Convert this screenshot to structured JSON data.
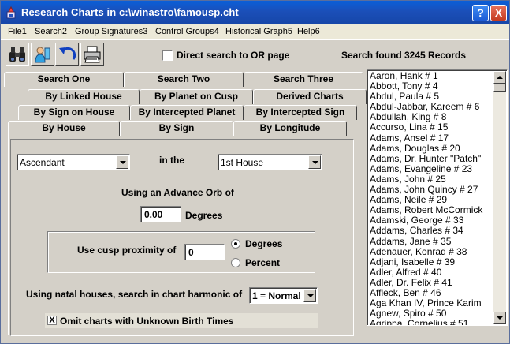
{
  "window": {
    "title": "Research Charts in c:\\winastro\\famousp.cht",
    "help_button": "?",
    "close_button": "X"
  },
  "menu": [
    {
      "label": "File",
      "num": "1"
    },
    {
      "label": "Search",
      "num": "2"
    },
    {
      "label": "Group Signatures",
      "num": "3"
    },
    {
      "label": "Control Groups",
      "num": "4"
    },
    {
      "label": "Historical Graph",
      "num": "5"
    },
    {
      "label": "Help",
      "num": "6"
    }
  ],
  "toolbar": {
    "icons": [
      "binoculars-icon",
      "person-search-icon",
      "undo-icon",
      "printer-icon"
    ],
    "direct_search_label": "Direct search to OR page",
    "direct_search_checked": false,
    "found_label": "Search found 3245 Records"
  },
  "tabs": {
    "row1": [
      "Search One",
      "Search Two",
      "Search Three"
    ],
    "row2": [
      "By Linked House",
      "By Planet on Cusp",
      "Derived Charts"
    ],
    "row3": [
      "By Sign on House",
      "By Intercepted Planet",
      "By Intercepted Sign"
    ],
    "row4": [
      "By House",
      "By Sign",
      "By Longitude"
    ],
    "active": "By House"
  },
  "form": {
    "planet_select": "Ascendant",
    "in_the_label": "in the",
    "house_select": "1st House",
    "orb_label": "Using an Advance Orb of",
    "orb_value": "0.00",
    "degrees_label": "Degrees",
    "cusp_label": "Use cusp proximity of",
    "cusp_value": "0",
    "radio_degrees": "Degrees",
    "radio_percent": "Percent",
    "radio_selected": "Degrees",
    "harmonic_label": "Using natal houses, search in chart harmonic of",
    "harmonic_select": "1 = Normal",
    "omit_label": "Omit charts with Unknown Birth Times",
    "omit_checked": true,
    "omit_check_mark": "X"
  },
  "list": [
    "Aaron, Hank  # 1",
    "Abbott, Tony  # 4",
    "Abdul, Paula  # 5",
    "Abdul-Jabbar, Kareem  # 6",
    "Abdullah, King  # 8",
    "Accurso, Lina  # 15",
    "Adams, Ansel  # 17",
    "Adams, Douglas  # 20",
    "Adams, Dr. Hunter \"Patch\"",
    "Adams, Evangeline  # 23",
    "Adams, John  # 25",
    "Adams, John Quincy  # 27",
    "Adams, Neile  # 29",
    "Adams, Robert McCormick",
    "Adamski, George  # 33",
    "Addams, Charles  # 34",
    "Addams, Jane  # 35",
    "Adenauer, Konrad  # 38",
    "Adjani, Isabelle  # 39",
    "Adler, Alfred  # 40",
    "Adler, Dr. Felix  # 41",
    "Affleck, Ben  # 46",
    "Aga Khan IV, Prince Karim",
    "Agnew, Spiro  # 50",
    "Agrippa, Cornelius  # 51"
  ],
  "colors": {
    "title_bar": "#1646a8",
    "face": "#d4d0c8",
    "menu_bar": "#ece9d8"
  }
}
